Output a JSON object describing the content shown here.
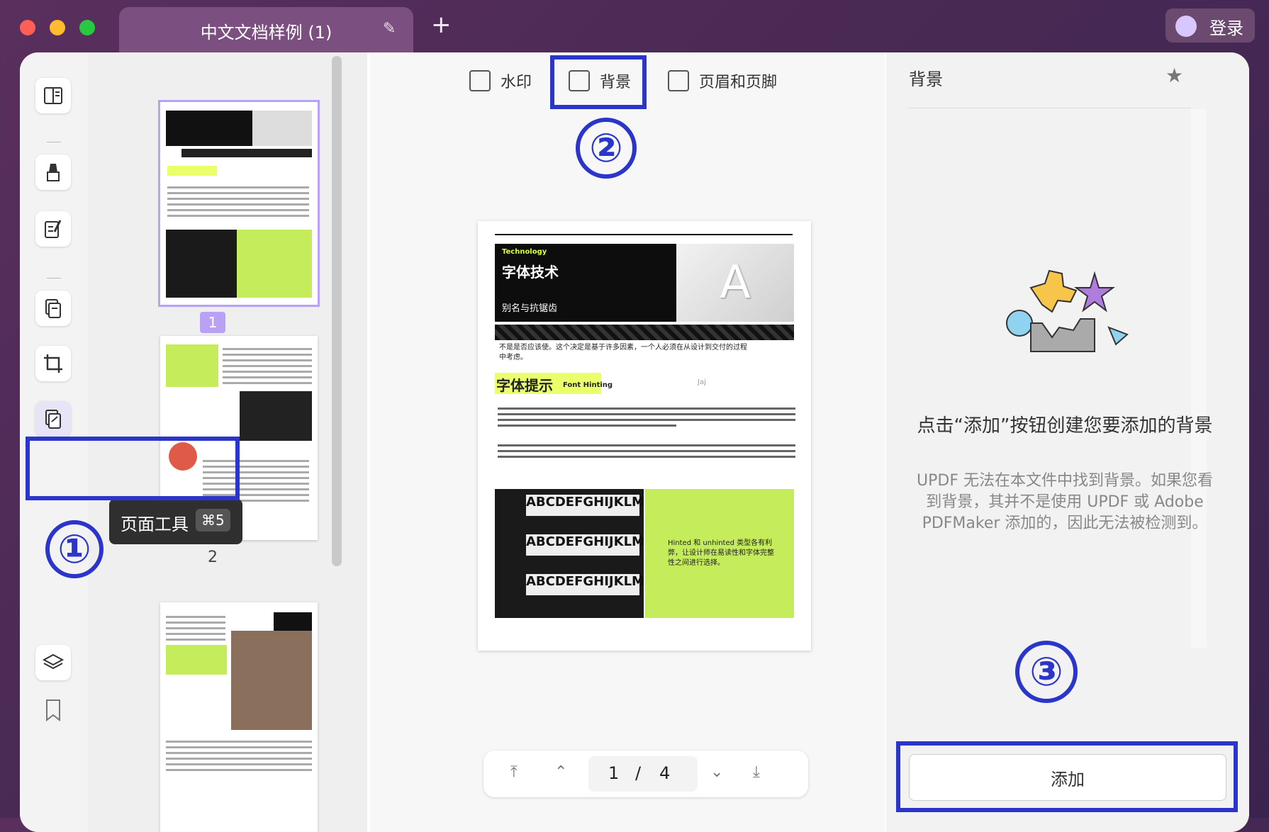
{
  "window": {
    "tab_title": "中文文档样例 (1)",
    "new_tab": "+",
    "login_label": "登录"
  },
  "sidebar": {
    "tooltip": {
      "label": "页面工具",
      "shortcut": "⌘5"
    }
  },
  "thumbnails": [
    {
      "page_label": "1"
    },
    {
      "page_label": "2"
    }
  ],
  "mode_tabs": [
    {
      "label": "水印"
    },
    {
      "label": "背景"
    },
    {
      "label": "页眉和页脚"
    }
  ],
  "annotations": {
    "one": "①",
    "two": "②",
    "three": "③"
  },
  "page_preview": {
    "tech_label": "Technology",
    "title": "字体技术",
    "subtitle": "别名与抗锯齿",
    "intro_line": "不是是否应该使。这个决定是基于许多因素，一个人必须在从设计到交付的过程",
    "intro_line2": "中考虑。",
    "section_title": "字体提示",
    "section_sub": "Font Hinting",
    "jaj": "Jaj",
    "alphabet": "ABCDEFGHIJKLMNO",
    "green_text": "Hinted 和 unhinted 类型各有利弊，让设计师在易读性和字体完整性之间进行选择。"
  },
  "pager": {
    "current": "1",
    "separator": "/",
    "total": "4"
  },
  "right_panel": {
    "title": "背景",
    "heading": "点击“添加”按钮创建您要添加的背景",
    "description": "UPDF 无法在本文件中找到背景。如果您看到背景，其并不是使用 UPDF 或 Adobe PDFMaker 添加的，因此无法被检测到。",
    "add_button": "添加"
  },
  "colors": {
    "highlight": "#2b35c9",
    "accent_purple": "#b9a1f5",
    "lime": "#c4ec5b"
  }
}
